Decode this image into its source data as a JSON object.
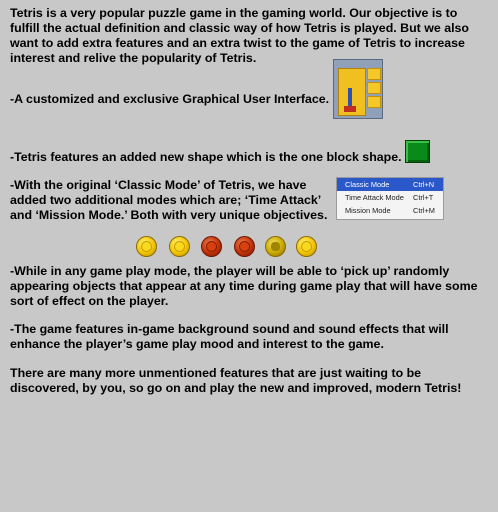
{
  "paragraphs": {
    "intro": "Tetris is a very popular puzzle game in the gaming world.  Our objective is to fulfill the actual definition and classic way of how Tetris is played.  But we also want to add extra features and an extra twist to the game of Tetris to increase interest and relive the popularity of Tetris.",
    "gui": "-A customized and exclusive Graphical User Interface.",
    "one_block": "-Tetris features an added new shape which is the one block shape.",
    "modes": "-With the original ‘Classic Mode’ of Tetris, we have added two additional modes which are; ‘Time Attack’ and ‘Mission Mode.’  Both with very unique objectives.",
    "pickup": "-While in any game play mode, the player will be able to ‘pick up’ randomly appearing objects that appear at any time during game play that will have some sort of effect on the player.",
    "sound": "-The game features in-game background sound and sound effects that will enhance the player’s game play mood and interest to the game.",
    "more": "There are many more unmentioned features that are just waiting to be discovered, by you, so go on and play the new and improved, modern Tetris!"
  },
  "mode_menu": {
    "items": [
      {
        "label": "Classic Mode",
        "shortcut": "Ctrl+N",
        "selected": true
      },
      {
        "label": "Time Attack Mode",
        "shortcut": "Ctrl+T",
        "selected": false
      },
      {
        "label": "Mission Mode",
        "shortcut": "Ctrl+M",
        "selected": false
      }
    ]
  },
  "colors": {
    "background": "#c8c8c8",
    "one_block": "#0a8a1a",
    "menu_highlight": "#2a58c8"
  },
  "icons": [
    "gui-thumbnail",
    "one-block-icon",
    "coin-icon"
  ]
}
